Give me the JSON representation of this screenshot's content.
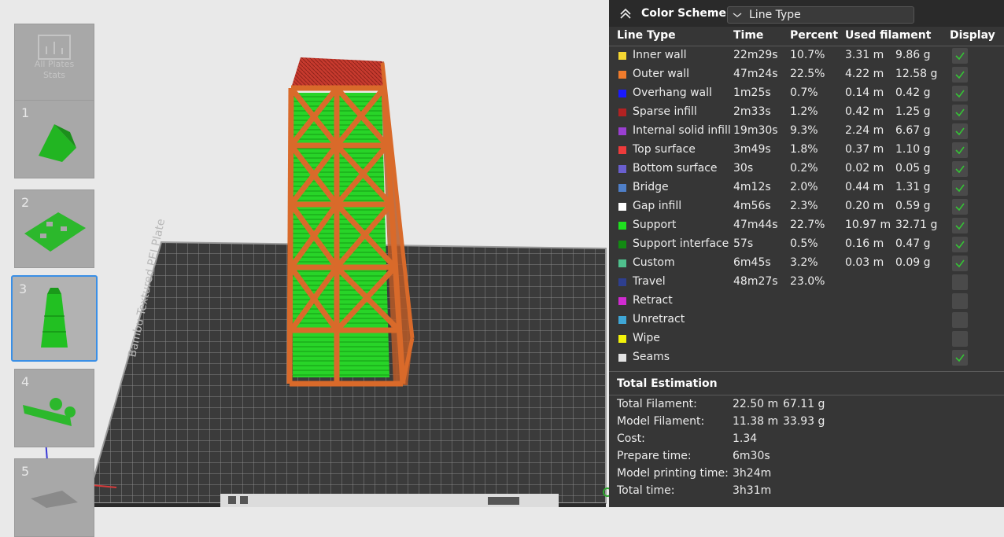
{
  "sidebar": {
    "all_plates_label": "All Plates\nStats",
    "plates": [
      {
        "num": "1"
      },
      {
        "num": "2"
      },
      {
        "num": "3"
      },
      {
        "num": "4"
      },
      {
        "num": "5"
      }
    ],
    "selected": "3"
  },
  "bed": {
    "label": "Bambu Textured PEI Plate"
  },
  "panel": {
    "title": "Color Scheme",
    "scheme_value": "Line Type",
    "headers": {
      "line_type": "Line Type",
      "time": "Time",
      "percent": "Percent",
      "used": "Used filament",
      "display": "Display"
    },
    "rows": [
      {
        "name": "Inner wall",
        "color": "#f5d732",
        "time": "22m29s",
        "percent": "10.7%",
        "meters": "3.31 m",
        "grams": "9.86 g",
        "display": true
      },
      {
        "name": "Outer wall",
        "color": "#f07b2c",
        "time": "47m24s",
        "percent": "22.5%",
        "meters": "4.22 m",
        "grams": "12.58 g",
        "display": true
      },
      {
        "name": "Overhang wall",
        "color": "#1a1aff",
        "time": "1m25s",
        "percent": "0.7%",
        "meters": "0.14 m",
        "grams": "0.42 g",
        "display": true
      },
      {
        "name": "Sparse infill",
        "color": "#b22222",
        "time": "2m33s",
        "percent": "1.2%",
        "meters": "0.42 m",
        "grams": "1.25 g",
        "display": true
      },
      {
        "name": "Internal solid infill",
        "color": "#9a3fd1",
        "time": "19m30s",
        "percent": "9.3%",
        "meters": "2.24 m",
        "grams": "6.67 g",
        "display": true
      },
      {
        "name": "Top surface",
        "color": "#ee3b3b",
        "time": "3m49s",
        "percent": "1.8%",
        "meters": "0.37 m",
        "grams": "1.10 g",
        "display": true
      },
      {
        "name": "Bottom surface",
        "color": "#6a5fcf",
        "time": "30s",
        "percent": "0.2%",
        "meters": "0.02 m",
        "grams": "0.05 g",
        "display": true
      },
      {
        "name": "Bridge",
        "color": "#4f7fc8",
        "time": "4m12s",
        "percent": "2.0%",
        "meters": "0.44 m",
        "grams": "1.31 g",
        "display": true
      },
      {
        "name": "Gap infill",
        "color": "#ffffff",
        "time": "4m56s",
        "percent": "2.3%",
        "meters": "0.20 m",
        "grams": "0.59 g",
        "display": true
      },
      {
        "name": "Support",
        "color": "#1fe01f",
        "time": "47m44s",
        "percent": "22.7%",
        "meters": "10.97 m",
        "grams": "32.71 g",
        "display": true
      },
      {
        "name": "Support interface",
        "color": "#128a12",
        "time": "57s",
        "percent": "0.5%",
        "meters": "0.16 m",
        "grams": "0.47 g",
        "display": true
      },
      {
        "name": "Custom",
        "color": "#4fc08d",
        "time": "6m45s",
        "percent": "3.2%",
        "meters": "0.03 m",
        "grams": "0.09 g",
        "display": true
      },
      {
        "name": "Travel",
        "color": "#2e3f8f",
        "time": "48m27s",
        "percent": "23.0%",
        "meters": "",
        "grams": "",
        "display": false
      },
      {
        "name": "Retract",
        "color": "#d02bd0",
        "time": "",
        "percent": "",
        "meters": "",
        "grams": "",
        "display": false
      },
      {
        "name": "Unretract",
        "color": "#3fa7d6",
        "time": "",
        "percent": "",
        "meters": "",
        "grams": "",
        "display": false
      },
      {
        "name": "Wipe",
        "color": "#f2f20a",
        "time": "",
        "percent": "",
        "meters": "",
        "grams": "",
        "display": false
      },
      {
        "name": "Seams",
        "color": "#e3e3e3",
        "time": "",
        "percent": "",
        "meters": "",
        "grams": "",
        "display": true
      }
    ],
    "total_title": "Total Estimation",
    "summary": [
      {
        "label": "Total Filament:",
        "v1": "22.50 m",
        "v2": "67.11 g"
      },
      {
        "label": "Model Filament:",
        "v1": "11.38 m",
        "v2": "33.93 g"
      },
      {
        "label": "Cost:",
        "v1": "1.34",
        "v2": ""
      },
      {
        "label": "Prepare time:",
        "v1": "6m30s",
        "v2": ""
      },
      {
        "label": "Model printing time:",
        "v1": "3h24m",
        "v2": ""
      },
      {
        "label": "Total time:",
        "v1": "3h31m",
        "v2": ""
      }
    ]
  }
}
